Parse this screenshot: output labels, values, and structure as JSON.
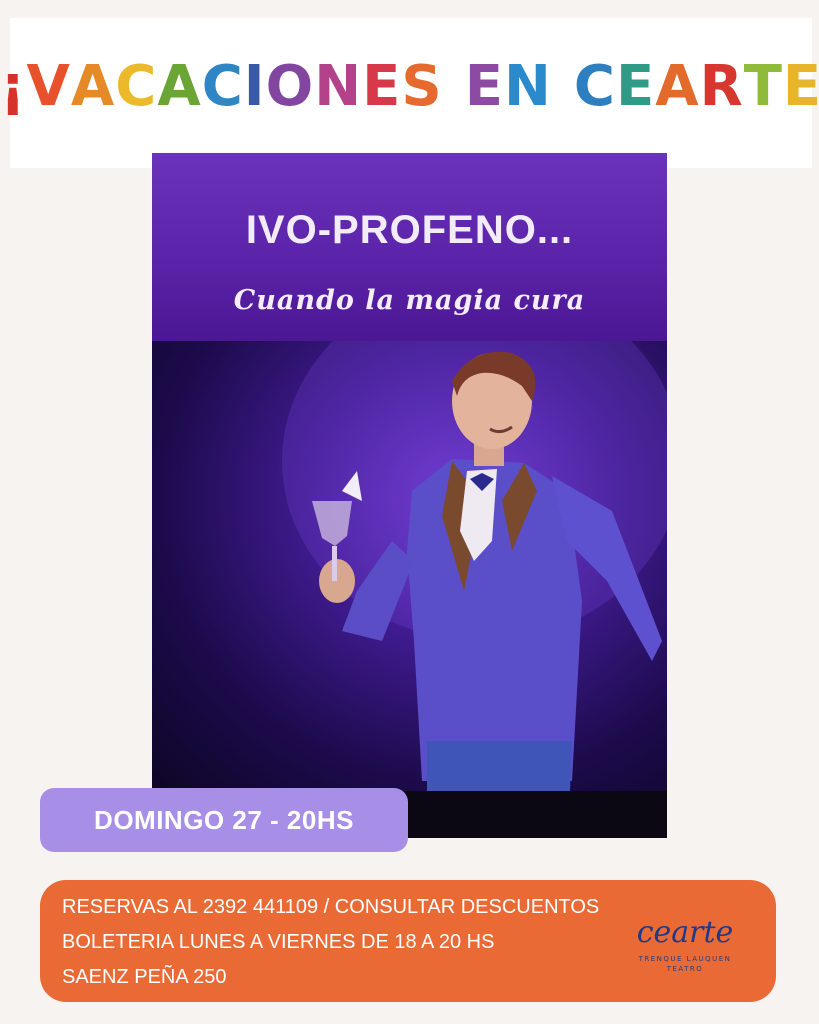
{
  "headline": {
    "letters": [
      {
        "ch": "¡",
        "color": "#d5322b"
      },
      {
        "ch": "V",
        "color": "#e7512b"
      },
      {
        "ch": "A",
        "color": "#e58a26"
      },
      {
        "ch": "C",
        "color": "#ecb92a"
      },
      {
        "ch": "A",
        "color": "#6aa535"
      },
      {
        "ch": "C",
        "color": "#2e86c4"
      },
      {
        "ch": "I",
        "color": "#3a5aa8"
      },
      {
        "ch": "O",
        "color": "#8245a0"
      },
      {
        "ch": "N",
        "color": "#b4428a"
      },
      {
        "ch": "E",
        "color": "#d7394a"
      },
      {
        "ch": "S",
        "color": "#e66a2d"
      },
      {
        "ch": " ",
        "color": "#000000"
      },
      {
        "ch": "E",
        "color": "#8c4aa3"
      },
      {
        "ch": "N",
        "color": "#2a8acb"
      },
      {
        "ch": " ",
        "color": "#000000"
      },
      {
        "ch": "C",
        "color": "#2d7fc0"
      },
      {
        "ch": "E",
        "color": "#2f9a85"
      },
      {
        "ch": "A",
        "color": "#e26b2c"
      },
      {
        "ch": "R",
        "color": "#d6382f"
      },
      {
        "ch": "T",
        "color": "#8fba3a"
      },
      {
        "ch": "E",
        "color": "#e8b42a"
      },
      {
        "ch": "!",
        "color": "#d8312b"
      }
    ]
  },
  "poster": {
    "title": "IVO-PROFENO...",
    "subtitle": "Cuando  la magia cura"
  },
  "date_pill": {
    "text": "DOMINGO 27 - 20HS",
    "color": "#a78ee6"
  },
  "info": {
    "line1": "RESERVAS AL 2392 441109 / CONSULTAR DESCUENTOS",
    "line2": "BOLETERIA LUNES A VIERNES DE 18 A 20 HS",
    "line3": "SAENZ PEÑA 250",
    "color": "#ea6a35"
  },
  "logo": {
    "name": "cearte",
    "tagline": "TRENQUE LAUQUEN",
    "tagline2": "TEATRO"
  }
}
